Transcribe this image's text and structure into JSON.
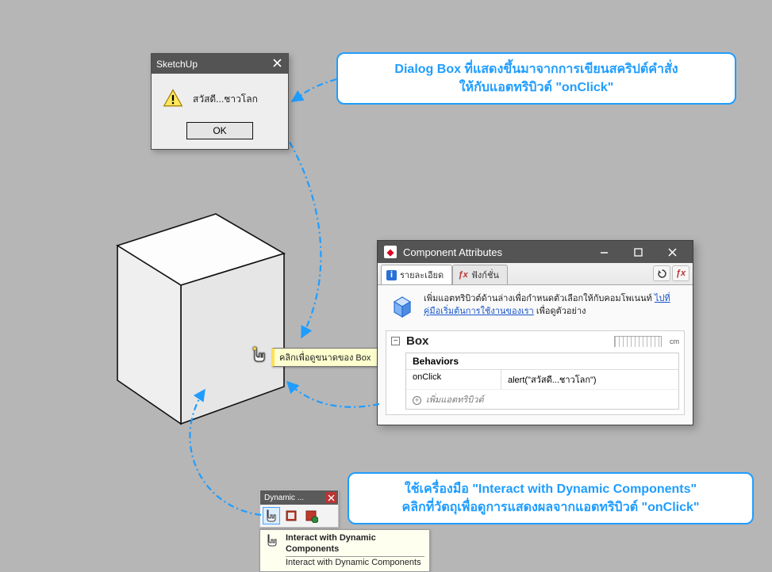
{
  "alert": {
    "title": "SketchUp",
    "message": "สวัสดี...ชาวโลก",
    "ok": "OK"
  },
  "callout_top": {
    "line1": "Dialog Box ที่แสดงขึ้นมาจากการเขียนสคริปต์คำสั่ง",
    "line2": "ให้กับแอตทริบิวต์ \"onClick\""
  },
  "callout_bot": {
    "line1": "ใช้เครื่องมือ \"Interact with Dynamic Components\"",
    "line2": "คลิกที่วัตถุเพื่อดูการแสดงผลจากแอตทริบิวต์ \"onClick\""
  },
  "cursor_tooltip": "คลิกเพื่อดูขนาดของ Box",
  "ca": {
    "title": "Component Attributes",
    "tab_info": "รายละเอียด",
    "tab_fx": "ฟังก์ชั่น",
    "intro_prefix": "เพิ่มแอตทริบิวต์ด้านล่างเพื่อกำหนดตัวเลือกให้กับคอมโพเนนท์ ",
    "intro_link": "ไปที่คู่มือเริ่มต้นการใช้งานของเรา",
    "intro_suffix": " เพื่อดูตัวอย่าง",
    "box_name": "Box",
    "unit": "cm",
    "behaviors": "Behaviors",
    "attr_name": "onClick",
    "attr_value": "alert(\"สวัสดี...ชาวโลก\")",
    "add_attr": "เพิ่มแอตทริบิวต์"
  },
  "dyn": {
    "title": "Dynamic ...",
    "tip_title": "Interact with Dynamic Components",
    "tip_sub": "Interact with Dynamic Components"
  }
}
